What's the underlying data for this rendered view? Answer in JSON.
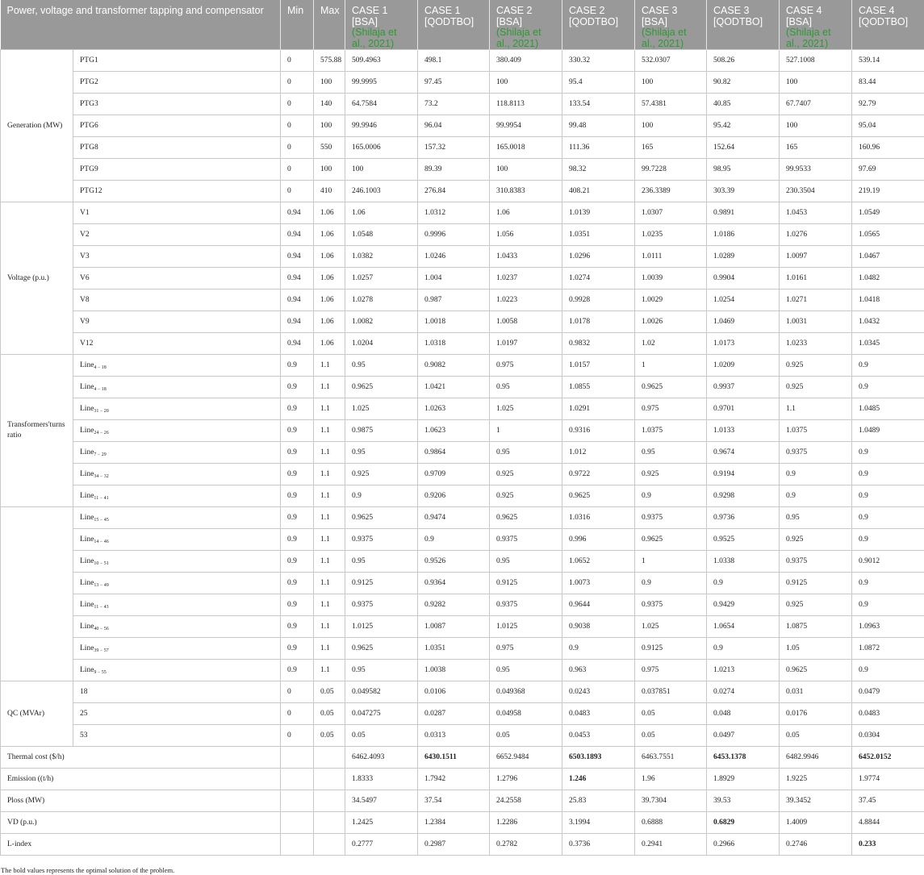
{
  "header": {
    "param": "Power, voltage and transformer tapping and compensator",
    "min": "Min",
    "max": "Max",
    "cases": [
      {
        "name": "CASE 1",
        "method": "[BSA]",
        "ref": "(Shilaja et al., 2021)"
      },
      {
        "name": "CASE 1",
        "method": "[QODTBO]",
        "ref": ""
      },
      {
        "name": "CASE 2",
        "method": "[BSA]",
        "ref": "(Shilaja et al., 2021)"
      },
      {
        "name": "CASE 2",
        "method": "[QODTBO]",
        "ref": ""
      },
      {
        "name": "CASE 3",
        "method": "[BSA]",
        "ref": "(Shilaja et al., 2021)"
      },
      {
        "name": "CASE 3",
        "method": "[QODTBO]",
        "ref": ""
      },
      {
        "name": "CASE 4",
        "method": "[BSA]",
        "ref": "(Shilaja et al., 2021)"
      },
      {
        "name": "CASE 4",
        "method": "[QODTBO]",
        "ref": ""
      }
    ]
  },
  "groups": [
    {
      "label": "Generation (MW)",
      "rows": [
        {
          "name": "PTG1",
          "sub": "",
          "min": "0",
          "max": "575.88",
          "v": [
            "509.4963",
            "498.1",
            "380.409",
            "330.32",
            "532.0307",
            "508.26",
            "527.1008",
            "539.14"
          ]
        },
        {
          "name": "PTG2",
          "sub": "",
          "min": "0",
          "max": "100",
          "v": [
            "99.9995",
            "97.45",
            "100",
            "95.4",
            "100",
            "90.82",
            "100",
            "83.44"
          ]
        },
        {
          "name": "PTG3",
          "sub": "",
          "min": "0",
          "max": "140",
          "v": [
            "64.7584",
            "73.2",
            "118.8113",
            "133.54",
            "57.4381",
            "40.85",
            "67.7407",
            "92.79"
          ]
        },
        {
          "name": "PTG6",
          "sub": "",
          "min": "0",
          "max": "100",
          "v": [
            "99.9946",
            "96.04",
            "99.9954",
            "99.48",
            "100",
            "95.42",
            "100",
            "95.04"
          ]
        },
        {
          "name": "PTG8",
          "sub": "",
          "min": "0",
          "max": "550",
          "v": [
            "165.0006",
            "157.32",
            "165.0018",
            "111.36",
            "165",
            "152.64",
            "165",
            "160.96"
          ]
        },
        {
          "name": "PTG9",
          "sub": "",
          "min": "0",
          "max": "100",
          "v": [
            "100",
            "89.39",
            "100",
            "98.32",
            "99.7228",
            "98.95",
            "99.9533",
            "97.69"
          ]
        },
        {
          "name": "PTG12",
          "sub": "",
          "min": "0",
          "max": "410",
          "v": [
            "246.1003",
            "276.84",
            "310.8383",
            "408.21",
            "236.3389",
            "303.39",
            "230.3504",
            "219.19"
          ]
        }
      ]
    },
    {
      "label": "Voltage (p.u.)",
      "rows": [
        {
          "name": "V1",
          "sub": "",
          "min": "0.94",
          "max": "1.06",
          "v": [
            "1.06",
            "1.0312",
            "1.06",
            "1.0139",
            "1.0307",
            "0.9891",
            "1.0453",
            "1.0549"
          ]
        },
        {
          "name": "V2",
          "sub": "",
          "min": "0.94",
          "max": "1.06",
          "v": [
            "1.0548",
            "0.9996",
            "1.056",
            "1.0351",
            "1.0235",
            "1.0186",
            "1.0276",
            "1.0565"
          ]
        },
        {
          "name": "V3",
          "sub": "",
          "min": "0.94",
          "max": "1.06",
          "v": [
            "1.0382",
            "1.0246",
            "1.0433",
            "1.0296",
            "1.0111",
            "1.0289",
            "1.0097",
            "1.0467"
          ]
        },
        {
          "name": "V6",
          "sub": "",
          "min": "0.94",
          "max": "1.06",
          "v": [
            "1.0257",
            "1.004",
            "1.0237",
            "1.0274",
            "1.0039",
            "0.9904",
            "1.0161",
            "1.0482"
          ]
        },
        {
          "name": "V8",
          "sub": "",
          "min": "0.94",
          "max": "1.06",
          "v": [
            "1.0278",
            "0.987",
            "1.0223",
            "0.9928",
            "1.0029",
            "1.0254",
            "1.0271",
            "1.0418"
          ]
        },
        {
          "name": "V9",
          "sub": "",
          "min": "0.94",
          "max": "1.06",
          "v": [
            "1.0082",
            "1.0018",
            "1.0058",
            "1.0178",
            "1.0026",
            "1.0469",
            "1.0031",
            "1.0432"
          ]
        },
        {
          "name": "V12",
          "sub": "",
          "min": "0.94",
          "max": "1.06",
          "v": [
            "1.0204",
            "1.0318",
            "1.0197",
            "0.9832",
            "1.02",
            "1.0173",
            "1.0233",
            "1.0345"
          ]
        }
      ]
    },
    {
      "label": "Transformers'turns ratio",
      "rows": [
        {
          "name": "Line",
          "sub": "4 − 18",
          "min": "0.9",
          "max": "1.1",
          "v": [
            "0.95",
            "0.9082",
            "0.975",
            "1.0157",
            "1",
            "1.0209",
            "0.925",
            "0.9"
          ]
        },
        {
          "name": "Line",
          "sub": "4 − 18",
          "min": "0.9",
          "max": "1.1",
          "v": [
            "0.9625",
            "1.0421",
            "0.95",
            "1.0855",
            "0.9625",
            "0.9937",
            "0.925",
            "0.9"
          ]
        },
        {
          "name": "Line",
          "sub": "31 − 20",
          "min": "0.9",
          "max": "1.1",
          "v": [
            "1.025",
            "1.0263",
            "1.025",
            "1.0291",
            "0.975",
            "0.9701",
            "1.1",
            "1.0485"
          ]
        },
        {
          "name": "Line",
          "sub": "24 − 26",
          "min": "0.9",
          "max": "1.1",
          "v": [
            "0.9875",
            "1.0623",
            "1",
            "0.9316",
            "1.0375",
            "1.0133",
            "1.0375",
            "1.0489"
          ]
        },
        {
          "name": "Line",
          "sub": "7 − 29",
          "min": "0.9",
          "max": "1.1",
          "v": [
            "0.95",
            "0.9864",
            "0.95",
            "1.012",
            "0.95",
            "0.9674",
            "0.9375",
            "0.9"
          ]
        },
        {
          "name": "Line",
          "sub": "34 − 32",
          "min": "0.9",
          "max": "1.1",
          "v": [
            "0.925",
            "0.9709",
            "0.925",
            "0.9722",
            "0.925",
            "0.9194",
            "0.9",
            "0.9"
          ]
        },
        {
          "name": "Line",
          "sub": "11 − 41",
          "min": "0.9",
          "max": "1.1",
          "v": [
            "0.9",
            "0.9206",
            "0.925",
            "0.9625",
            "0.9",
            "0.9298",
            "0.9",
            "0.9"
          ]
        }
      ]
    },
    {
      "label": "",
      "rows": [
        {
          "name": "Line",
          "sub": "15 − 45",
          "min": "0.9",
          "max": "1.1",
          "v": [
            "0.9625",
            "0.9474",
            "0.9625",
            "1.0316",
            "0.9375",
            "0.9736",
            "0.95",
            "0.9"
          ]
        },
        {
          "name": "Line",
          "sub": "14 − 46",
          "min": "0.9",
          "max": "1.1",
          "v": [
            "0.9375",
            "0.9",
            "0.9375",
            "0.996",
            "0.9625",
            "0.9525",
            "0.925",
            "0.9"
          ]
        },
        {
          "name": "Line",
          "sub": "10 − 51",
          "min": "0.9",
          "max": "1.1",
          "v": [
            "0.95",
            "0.9526",
            "0.95",
            "1.0652",
            "1",
            "1.0338",
            "0.9375",
            "0.9012"
          ]
        },
        {
          "name": "Line",
          "sub": "13 − 49",
          "min": "0.9",
          "max": "1.1",
          "v": [
            "0.9125",
            "0.9364",
            "0.9125",
            "1.0073",
            "0.9",
            "0.9",
            "0.9125",
            "0.9"
          ]
        },
        {
          "name": "Line",
          "sub": "11 − 43",
          "min": "0.9",
          "max": "1.1",
          "v": [
            "0.9375",
            "0.9282",
            "0.9375",
            "0.9644",
            "0.9375",
            "0.9429",
            "0.925",
            "0.9"
          ]
        },
        {
          "name": "Line",
          "sub": "40 − 56",
          "min": "0.9",
          "max": "1.1",
          "v": [
            "1.0125",
            "1.0087",
            "1.0125",
            "0.9038",
            "1.025",
            "1.0654",
            "1.0875",
            "1.0963"
          ]
        },
        {
          "name": "Line",
          "sub": "39 − 57",
          "min": "0.9",
          "max": "1.1",
          "v": [
            "0.9625",
            "1.0351",
            "0.975",
            "0.9",
            "0.9125",
            "0.9",
            "1.05",
            "1.0872"
          ]
        },
        {
          "name": "Line",
          "sub": "9 − 55",
          "min": "0.9",
          "max": "1.1",
          "v": [
            "0.95",
            "1.0038",
            "0.95",
            "0.963",
            "0.975",
            "1.0213",
            "0.9625",
            "0.9"
          ]
        }
      ]
    },
    {
      "label": "QC (MVAr)",
      "rows": [
        {
          "name": "18",
          "sub": "",
          "min": "0",
          "max": "0.05",
          "v": [
            "0.049582",
            "0.0106",
            "0.049368",
            "0.0243",
            "0.037851",
            "0.0274",
            "0.031",
            "0.0479"
          ]
        },
        {
          "name": "25",
          "sub": "",
          "min": "0",
          "max": "0.05",
          "v": [
            "0.047275",
            "0.0287",
            "0.04958",
            "0.0483",
            "0.05",
            "0.048",
            "0.0176",
            "0.0483"
          ]
        },
        {
          "name": "53",
          "sub": "",
          "min": "0",
          "max": "0.05",
          "v": [
            "0.05",
            "0.0313",
            "0.05",
            "0.0453",
            "0.05",
            "0.0497",
            "0.05",
            "0.0304"
          ]
        }
      ]
    }
  ],
  "summary": [
    {
      "label": "Thermal cost ($/h)",
      "v": [
        "6462.4093",
        "6430.1511",
        "6652.9484",
        "6503.1893",
        "6463.7551",
        "6453.1378",
        "6482.9946",
        "6452.0152"
      ],
      "bold": [
        1,
        3,
        5,
        7
      ]
    },
    {
      "label": "Emission ((t/h)",
      "v": [
        "1.8333",
        "1.7942",
        "1.2796",
        "1.246",
        "1.96",
        "1.8929",
        "1.9225",
        "1.9774"
      ],
      "bold": [
        3
      ]
    },
    {
      "label": "Ploss (MW)",
      "v": [
        "34.5497",
        "37.54",
        "24.2558",
        "25.83",
        "39.7304",
        "39.53",
        "39.3452",
        "37.45"
      ],
      "bold": []
    },
    {
      "label": "VD (p.u.)",
      "v": [
        "1.2425",
        "1.2384",
        "1.2286",
        "3.1994",
        "0.6888",
        "0.6829",
        "1.4009",
        "4.8844"
      ],
      "bold": [
        5
      ]
    },
    {
      "label": "L-index",
      "v": [
        "0.2777",
        "0.2987",
        "0.2782",
        "0.3736",
        "0.2941",
        "0.2966",
        "0.2746",
        "0.233"
      ],
      "bold": [
        7
      ]
    }
  ],
  "footnote": "The bold values represents the optimal solution of the problem."
}
